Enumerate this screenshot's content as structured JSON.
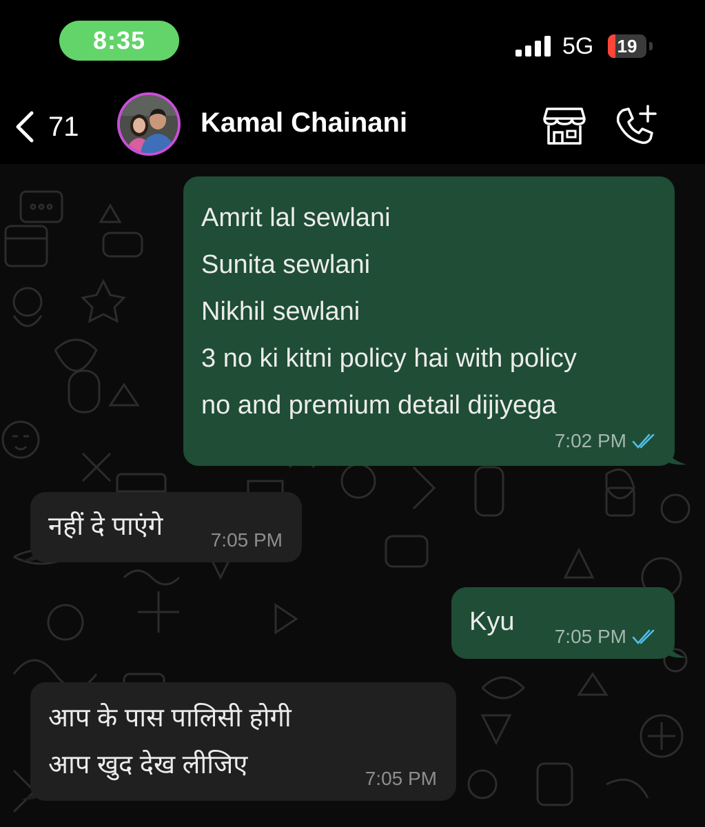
{
  "status_bar": {
    "time": "8:35",
    "network": "5G",
    "battery_level": "19",
    "battery_fraction": 0.19
  },
  "header": {
    "back_icon": "chevron-left-icon",
    "unread_count": "71",
    "contact_name": "Kamal Chainani",
    "actions": [
      {
        "icon": "storefront-icon"
      },
      {
        "icon": "phone-plus-icon"
      }
    ]
  },
  "colors": {
    "time_pill": "#62d46a",
    "outgoing_bubble": "#1f4d35",
    "incoming_bubble": "#202020",
    "read_ticks": "#53bdeb",
    "avatar_ring": "#c84fd8"
  },
  "messages": [
    {
      "direction": "outgoing",
      "lines": [
        "Amrit lal sewlani",
        "Sunita sewlani",
        "Nikhil sewlani",
        "3 no ki kitni policy hai with policy",
        "no and premium detail dijiyega"
      ],
      "time": "7:02 PM",
      "status": "read"
    },
    {
      "direction": "incoming",
      "lines": [
        "नहीं दे पाएंगे"
      ],
      "time": "7:05 PM"
    },
    {
      "direction": "outgoing",
      "lines": [
        "Kyu"
      ],
      "time": "7:05 PM",
      "status": "read"
    },
    {
      "direction": "incoming",
      "lines": [
        "आप के पास पालिसी होगी",
        "आप खुद देख लीजिए"
      ],
      "time": "7:05 PM"
    }
  ]
}
